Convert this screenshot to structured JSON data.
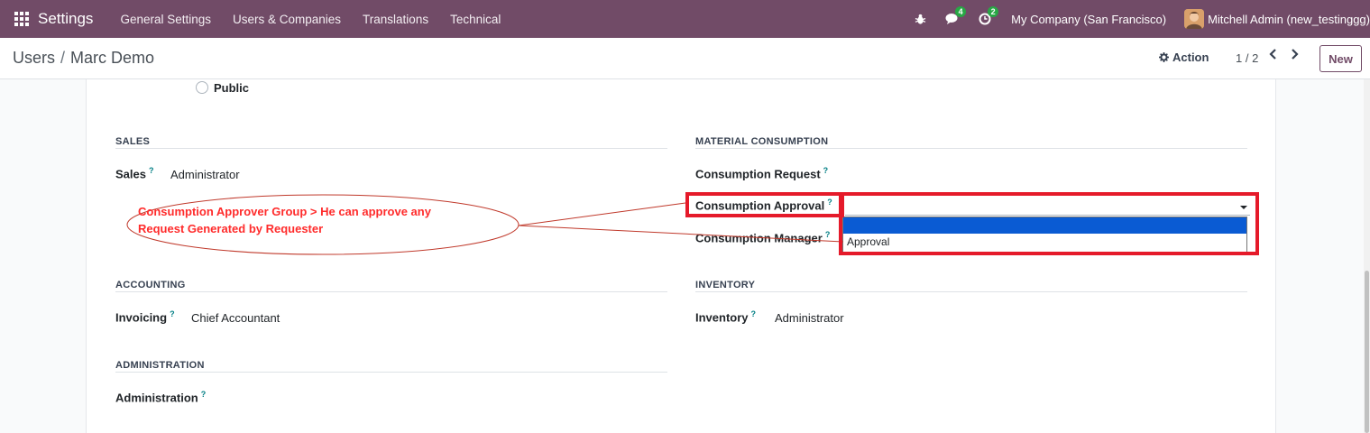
{
  "navbar": {
    "app_title": "Settings",
    "menu": [
      "General Settings",
      "Users & Companies",
      "Translations",
      "Technical"
    ],
    "chat_badge": "4",
    "activity_badge": "2",
    "company": "My Company (San Francisco)",
    "user": "Mitchell Admin (new_testinggg)",
    "bg_color": "#714b67"
  },
  "control": {
    "breadcrumb_parent": "Users",
    "breadcrumb_sep": "/",
    "breadcrumb_current": "Marc Demo",
    "action_label": "Action",
    "pager": "1 / 2",
    "new_label": "New"
  },
  "form": {
    "public_label": "Public",
    "help_mark": "?",
    "sales": {
      "title": "SALES",
      "sales_label": "Sales",
      "sales_value": "Administrator"
    },
    "material": {
      "title": "MATERIAL CONSUMPTION",
      "request_label": "Consumption Request",
      "approval_label": "Consumption Approval",
      "manager_label": "Consumption Manager",
      "dropdown_options": [
        "",
        "Approval"
      ]
    },
    "accounting": {
      "title": "ACCOUNTING",
      "invoicing_label": "Invoicing",
      "invoicing_value": "Chief Accountant"
    },
    "inventory": {
      "title": "INVENTORY",
      "inventory_label": "Inventory",
      "inventory_value": "Administrator"
    },
    "administration": {
      "title": "ADMINISTRATION",
      "admin_label": "Administration"
    }
  },
  "annotation": {
    "line1": "Consumption Approver Group > He can approve any",
    "line2": "Request Generated by Requester",
    "color": "#e51a2a"
  }
}
